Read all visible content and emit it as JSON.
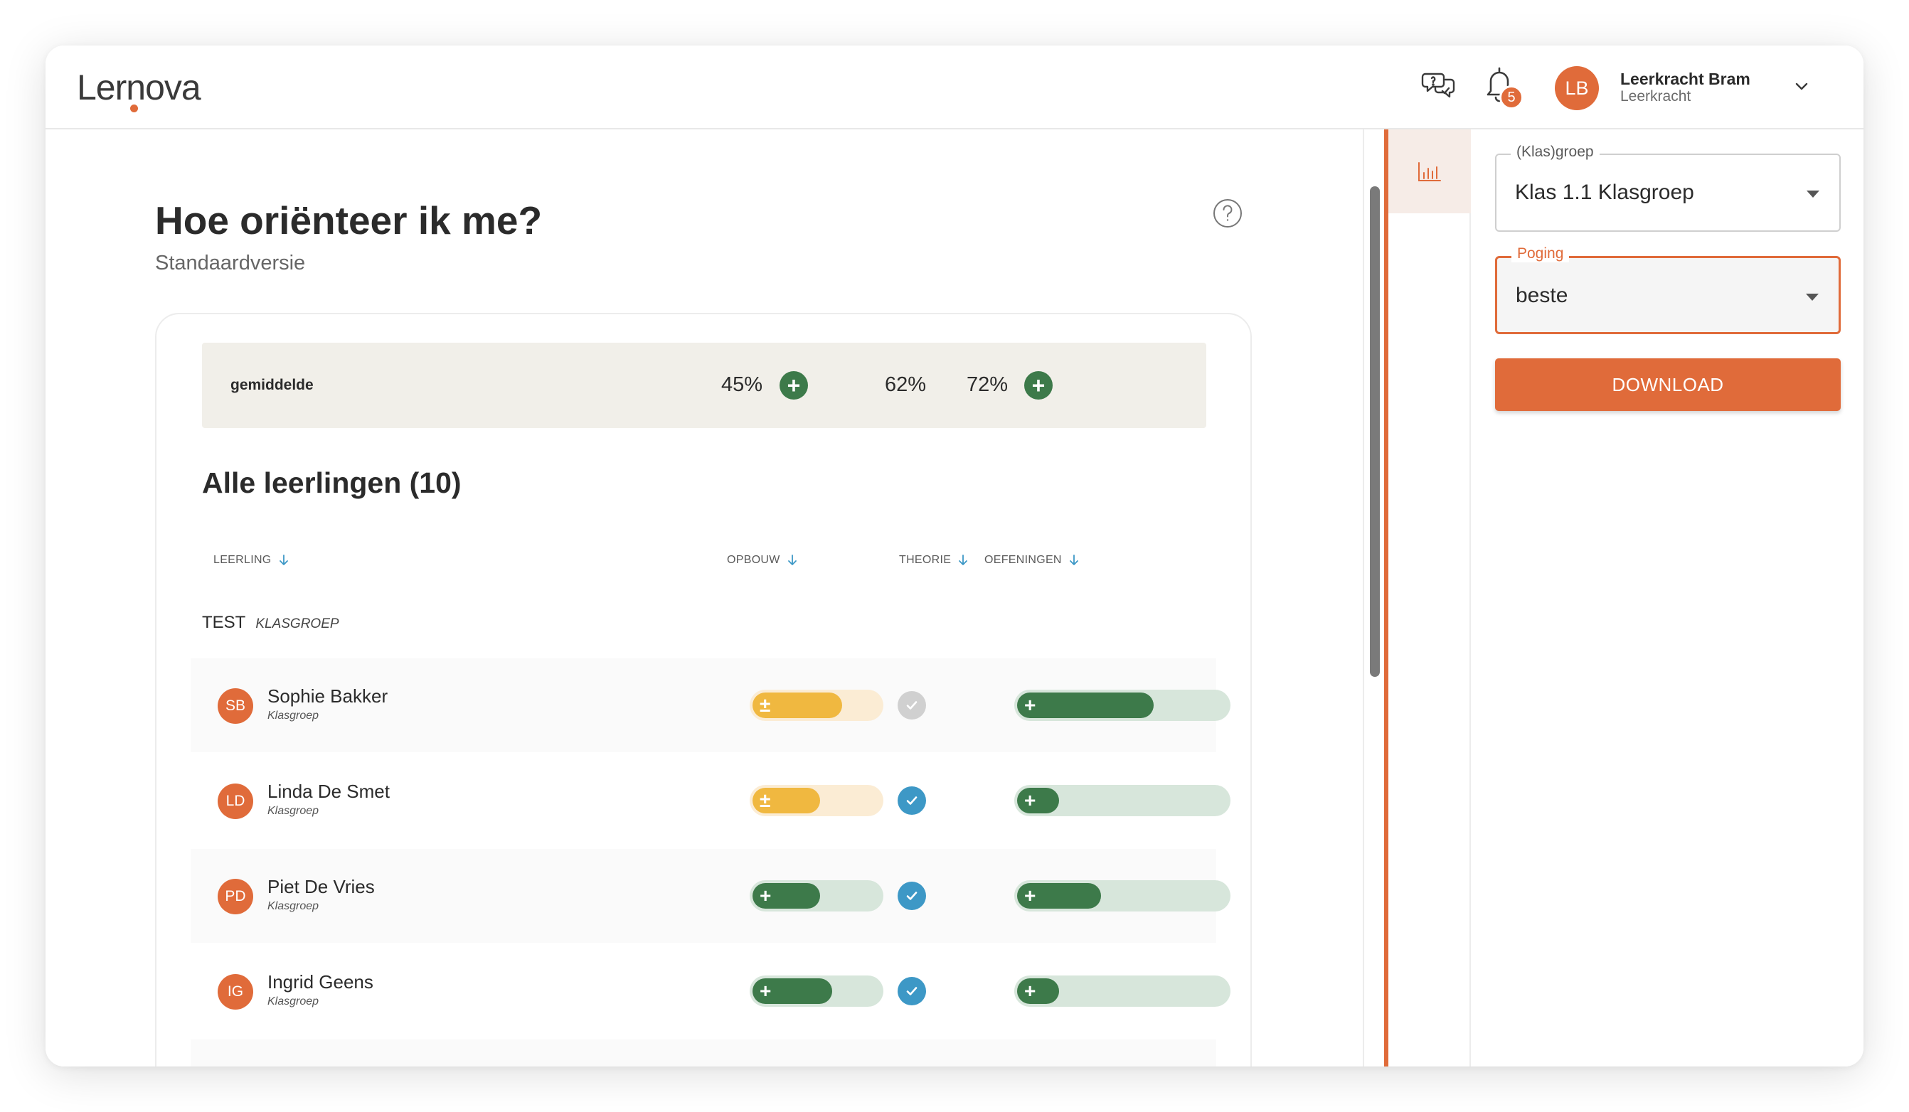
{
  "app": {
    "logo": "Lernova",
    "notifications_count": "5",
    "user": {
      "initials": "LB",
      "name": "Leerkracht Bram",
      "role": "Leerkracht"
    }
  },
  "page": {
    "title": "Hoe oriënteer ik me?",
    "subtitle": "Standaardversie"
  },
  "averages": {
    "label": "gemiddelde",
    "opbouw": "45%",
    "theorie": "62%",
    "oefeningen": "72%",
    "opbouw_badge": "+",
    "oefeningen_badge": "+"
  },
  "students_section": {
    "title": "Alle leerlingen (10)",
    "columns": [
      "LEERLING",
      "OPBOUW",
      "THEORIE",
      "OEFENINGEN"
    ],
    "group": {
      "name": "TEST",
      "type": "KLASGROEP"
    },
    "rows": [
      {
        "initials": "SB",
        "name": "Sophie Bakker",
        "group": "Klasgroep",
        "opbouw": {
          "symbol": "±",
          "status": "partial",
          "level": 0.7
        },
        "theorie": "pending",
        "oefeningen": {
          "symbol": "+",
          "status": "good",
          "level": 0.65
        }
      },
      {
        "initials": "LD",
        "name": "Linda De Smet",
        "group": "Klasgroep",
        "opbouw": {
          "symbol": "±",
          "status": "partial",
          "level": 0.53
        },
        "theorie": "done",
        "oefeningen": {
          "symbol": "+",
          "status": "good",
          "level": 0.2
        }
      },
      {
        "initials": "PD",
        "name": "Piet De Vries",
        "group": "Klasgroep",
        "opbouw": {
          "symbol": "+",
          "status": "good",
          "level": 0.53
        },
        "theorie": "done",
        "oefeningen": {
          "symbol": "+",
          "status": "good",
          "level": 0.4
        }
      },
      {
        "initials": "IG",
        "name": "Ingrid Geens",
        "group": "Klasgroep",
        "opbouw": {
          "symbol": "+",
          "status": "good",
          "level": 0.62
        },
        "theorie": "done",
        "oefeningen": {
          "symbol": "+",
          "status": "good",
          "level": 0.2
        }
      }
    ]
  },
  "filters": {
    "klasgroep": {
      "label": "(Klas)groep",
      "value": "Klas 1.1 Klasgroep"
    },
    "poging": {
      "label": "Poging",
      "value": "beste"
    },
    "download_label": "DOWNLOAD"
  },
  "icons": [
    "chat-icon",
    "bell-icon",
    "chevron-down-icon",
    "help-icon",
    "sort-arrow-icon",
    "check-icon",
    "bar-chart-icon",
    "caret-down-icon"
  ],
  "colors": {
    "accent": "#e06b3a",
    "good": "#3d7a4a",
    "partial": "#f0b840",
    "done": "#3d98c6",
    "pending": "#d0d0d0"
  }
}
